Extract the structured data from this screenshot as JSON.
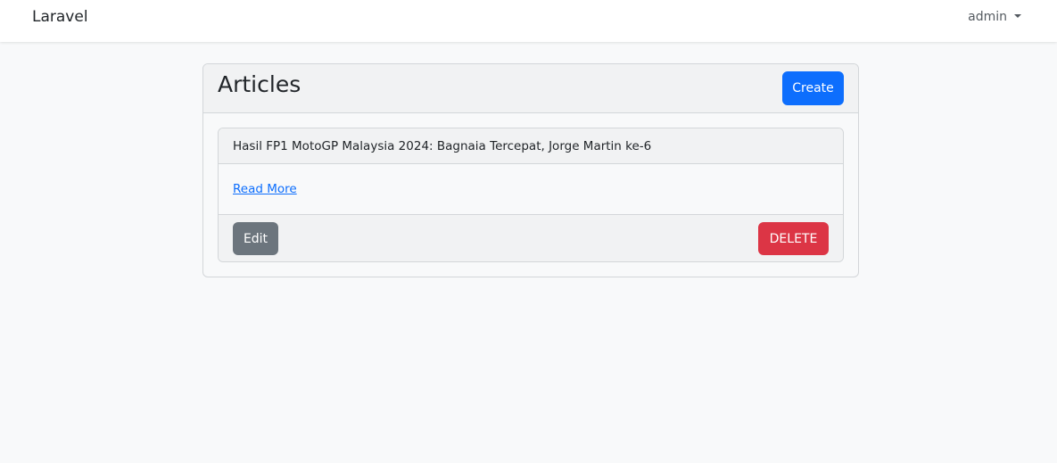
{
  "navbar": {
    "brand": "Laravel",
    "user_menu_label": "admin"
  },
  "articles_card": {
    "title": "Articles",
    "create_label": "Create",
    "items": [
      {
        "title": "Hasil FP1 MotoGP Malaysia 2024: Bagnaia Tercepat, Jorge Martin ke-6",
        "read_more_label": "Read More",
        "edit_label": "Edit",
        "delete_label": "DELETE"
      }
    ]
  },
  "colors": {
    "primary": "#0d6efd",
    "secondary": "#6c757d",
    "danger": "#dc3545",
    "background": "#f8f9fa",
    "header_background": "#f1f2f3"
  },
  "icons": {
    "user_menu": "caret-down-icon"
  }
}
